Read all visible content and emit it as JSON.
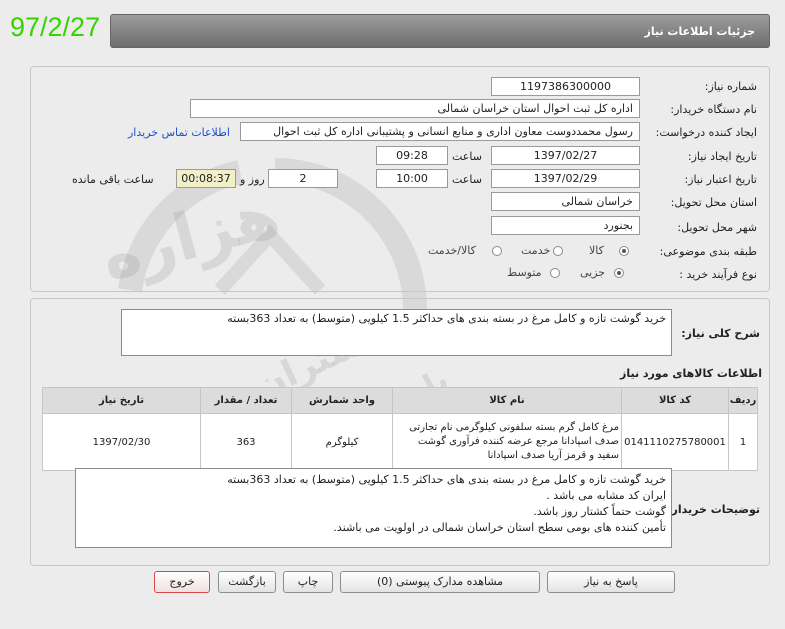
{
  "stamp_date": "97/2/27",
  "header_title": "جزئیات اطلاعات نیاز",
  "form": {
    "need_number_label": "شماره نیاز:",
    "need_number": "1197386300000",
    "buyer_org_label": "نام دستگاه خریدار:",
    "buyer_org": "اداره کل ثبت احوال استان خراسان شمالی",
    "requester_label": "ایجاد کننده درخواست:",
    "requester": "رسول محمددوست معاون اداری و منابع انسانی و پشتیبانی اداره کل ثبت احوال",
    "contact_link": "اطلاعات تماس خریدار",
    "created_label": "تاریخ ایجاد نیاز:",
    "created_date": "1397/02/27",
    "time_label": "ساعت",
    "created_time": "09:28",
    "valid_label": "تاریخ اعتبار نیاز:",
    "valid_date": "1397/02/29",
    "valid_time": "10:00",
    "days_value": "2",
    "days_label": "روز و",
    "remaining_time": "00:08:37",
    "remaining_label": "ساعت باقی مانده",
    "province_label": "استان محل تحویل:",
    "province": "خراسان شمالی",
    "city_label": "شهر محل تحویل:",
    "city": "بجنورد",
    "category_label": "طبقه بندی موضوعی:",
    "category_options": [
      "کالا",
      "خدمت",
      "کالا/خدمت"
    ],
    "category_selected": "کالا",
    "purchase_type_label": "نوع فرآیند خرید :",
    "purchase_type_options": [
      "جزیی",
      "متوسط"
    ],
    "purchase_type_selected": "جزیی"
  },
  "summary": {
    "label": "شرح کلی نیاز:",
    "text": "خرید گوشت تازه و کامل مرغ در بسته بندی های حداکثر 1.5 کیلویی (متوسط) به تعداد 363بسته"
  },
  "items_section_title": "اطلاعات کالاهای مورد نیاز",
  "items_table": {
    "headers": [
      "ردیف",
      "کد کالا",
      "نام کالا",
      "واحد شمارش",
      "تعداد / مقدار",
      "تاریخ نیاز"
    ],
    "rows": [
      {
        "row": "1",
        "code": "0141110275780001",
        "name": "مرغ کامل گرم بسته سلفونی کیلوگرمی نام تجارتی صدف اسپادانا مرجع عرضه کننده فرآوری گوشت سفید و قرمز آریا صدف اسپادانا",
        "unit": "کیلوگرم",
        "qty": "363",
        "date": "1397/02/30"
      }
    ]
  },
  "buyer_notes": {
    "label": "توضیحات خریدار:",
    "lines": [
      "خرید گوشت تازه و کامل مرغ در بسته بندی های حداکثر 1.5 کیلویی (متوسط) به تعداد 363بسته",
      "ایران کد مشابه می باشد .",
      "گوشت حتماً کشتار روز باشد.",
      "تأمین کننده های بومی سطح استان خراسان شمالی در اولویت می باشند."
    ]
  },
  "buttons": {
    "reply": "پاسخ به نیاز",
    "attachments": "مشاهده مدارک پیوستی (0)",
    "print": "چاپ",
    "back": "بازگشت",
    "exit": "خروج"
  },
  "watermark": {
    "line1": "هزاره",
    "line2": "گستران",
    "line3": "پارس"
  },
  "colors": {
    "stamp": "#35d400",
    "link": "#1a50c8",
    "exit_border": "#d9484a"
  }
}
